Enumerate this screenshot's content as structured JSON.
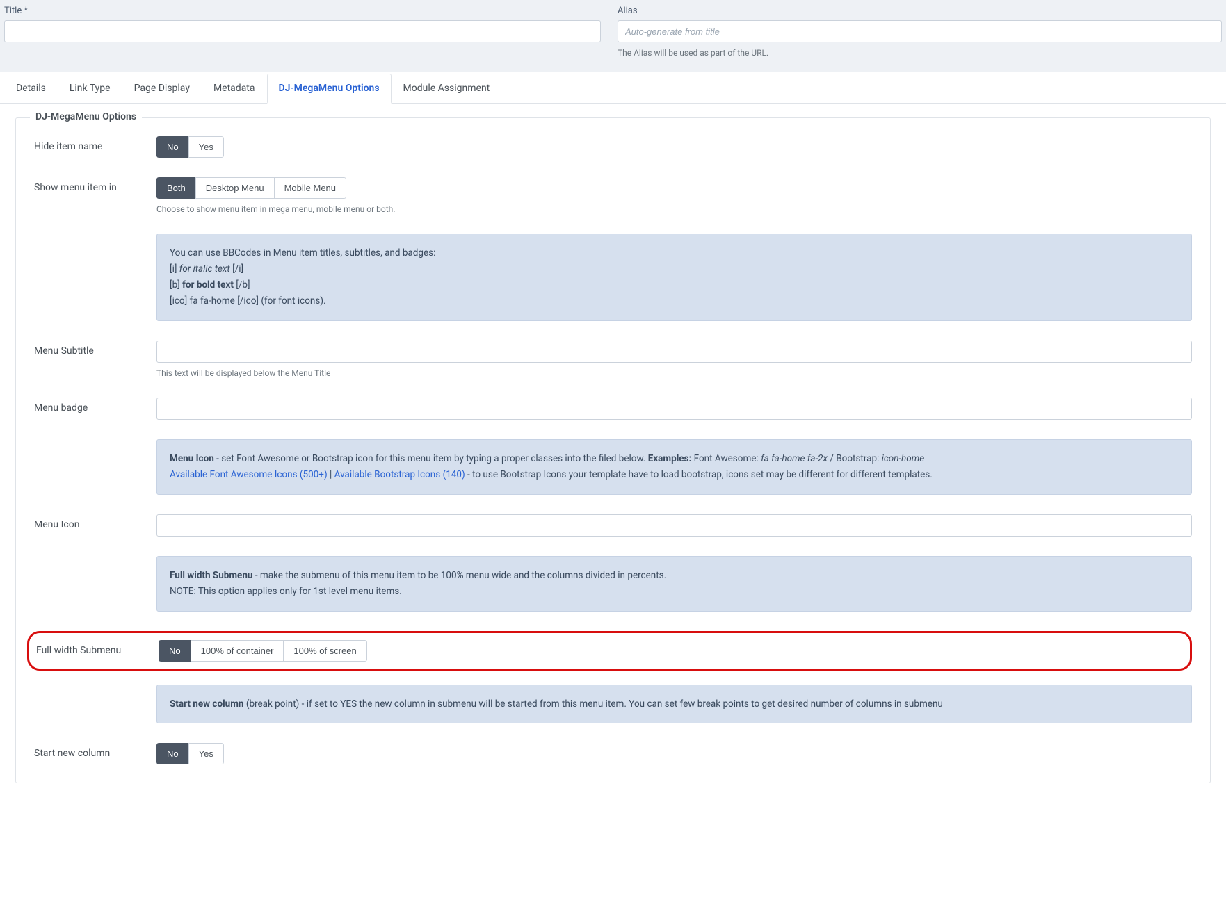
{
  "topFields": {
    "titleLabel": "Title *",
    "aliasLabel": "Alias",
    "aliasPlaceholder": "Auto-generate from title",
    "aliasHint": "The Alias will be used as part of the URL."
  },
  "tabs": {
    "details": "Details",
    "linkType": "Link Type",
    "pageDisplay": "Page Display",
    "metadata": "Metadata",
    "djOptions": "DJ-MegaMenu Options",
    "moduleAssignment": "Module Assignment"
  },
  "legend": "DJ-MegaMenu Options",
  "hideItemName": {
    "label": "Hide item name",
    "no": "No",
    "yes": "Yes"
  },
  "showMenuItemIn": {
    "label": "Show menu item in",
    "both": "Both",
    "desktop": "Desktop Menu",
    "mobile": "Mobile Menu",
    "hint": "Choose to show menu item in mega menu, mobile menu or both."
  },
  "bbcodeBox": {
    "line1": "You can use BBCodes in Menu item titles, subtitles, and badges:",
    "l2a": "[i] ",
    "l2b": "for italic text",
    "l2c": " [/i]",
    "l3a": "[b] ",
    "l3b": "for bold text",
    "l3c": " [/b]",
    "l4": "[ico] fa fa-home [/ico] (for font icons)."
  },
  "menuSubtitle": {
    "label": "Menu Subtitle",
    "hint": "This text will be displayed below the Menu Title"
  },
  "menuBadge": {
    "label": "Menu badge"
  },
  "menuIconBox": {
    "a1": "Menu Icon",
    "a2": " - set Font Awesome or Bootstrap icon for this menu item by typing a proper classes into the filed below. ",
    "a3": "Examples:",
    "a4": " Font Awesome: ",
    "a5": "fa fa-home fa-2x",
    "a6": " / Bootstrap: ",
    "a7": "icon-home",
    "link1": "Available Font Awesome Icons (500+)",
    "sep": " | ",
    "link2": "Available Bootstrap Icons (140)",
    "rest": " - to use Bootstrap Icons your template have to load bootstrap, icons set may be different for different templates."
  },
  "menuIcon": {
    "label": "Menu Icon"
  },
  "fullWidthBox": {
    "a1": "Full width Submenu",
    "a2": " - make the submenu of this menu item to be 100% menu wide and the columns divided in percents.",
    "note": "NOTE: This option applies only for 1st level menu items."
  },
  "fullWidth": {
    "label": "Full width Submenu",
    "no": "No",
    "container": "100% of container",
    "screen": "100% of screen"
  },
  "startNewColBox": {
    "a1": "Start new column",
    "a2": " (break point) - if set to YES the new column in submenu will be started from this menu item. You can set few break points to get desired number of columns in submenu"
  },
  "startNewCol": {
    "label": "Start new column",
    "no": "No",
    "yes": "Yes"
  }
}
